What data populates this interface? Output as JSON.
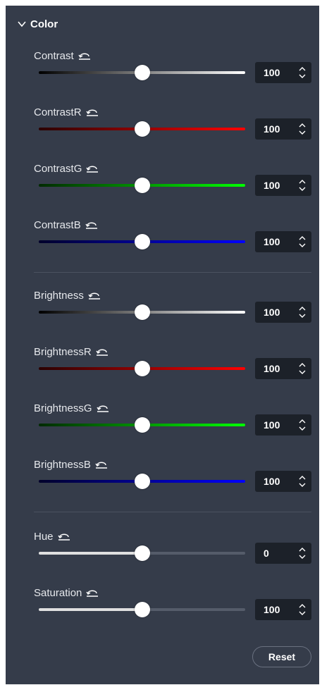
{
  "section": {
    "title": "Color",
    "expanded": true
  },
  "sliders": [
    {
      "label": "Contrast",
      "value": "100",
      "fraction": 0.5,
      "gradient": [
        "#000000",
        "#ffffff"
      ],
      "style": "gradient"
    },
    {
      "label": "ContrastR",
      "value": "100",
      "fraction": 0.5,
      "gradient": [
        "#2a0000",
        "#ff0000"
      ],
      "style": "gradient"
    },
    {
      "label": "ContrastG",
      "value": "100",
      "fraction": 0.5,
      "gradient": [
        "#002a00",
        "#00ff00"
      ],
      "style": "gradient"
    },
    {
      "label": "ContrastB",
      "value": "100",
      "fraction": 0.5,
      "gradient": [
        "#00002a",
        "#0000ff"
      ],
      "style": "gradient"
    },
    {
      "label": "Brightness",
      "value": "100",
      "fraction": 0.5,
      "gradient": [
        "#000000",
        "#ffffff"
      ],
      "style": "gradient"
    },
    {
      "label": "BrightnessR",
      "value": "100",
      "fraction": 0.5,
      "gradient": [
        "#2a0000",
        "#ff0000"
      ],
      "style": "gradient"
    },
    {
      "label": "BrightnessG",
      "value": "100",
      "fraction": 0.5,
      "gradient": [
        "#002a00",
        "#00ff00"
      ],
      "style": "gradient"
    },
    {
      "label": "BrightnessB",
      "value": "100",
      "fraction": 0.5,
      "gradient": [
        "#00002a",
        "#0000ff"
      ],
      "style": "gradient"
    },
    {
      "label": "Hue",
      "value": "0",
      "fraction": 0.5,
      "gradient": [
        "#e0e0e0",
        "#555c6a"
      ],
      "style": "filled"
    },
    {
      "label": "Saturation",
      "value": "100",
      "fraction": 0.5,
      "gradient": [
        "#e0e0e0",
        "#555c6a"
      ],
      "style": "filled"
    }
  ],
  "footer": {
    "reset_label": "Reset"
  },
  "colors": {
    "panel_bg": "#353c4a",
    "input_bg": "#1c2129",
    "divider": "#4b5260"
  }
}
